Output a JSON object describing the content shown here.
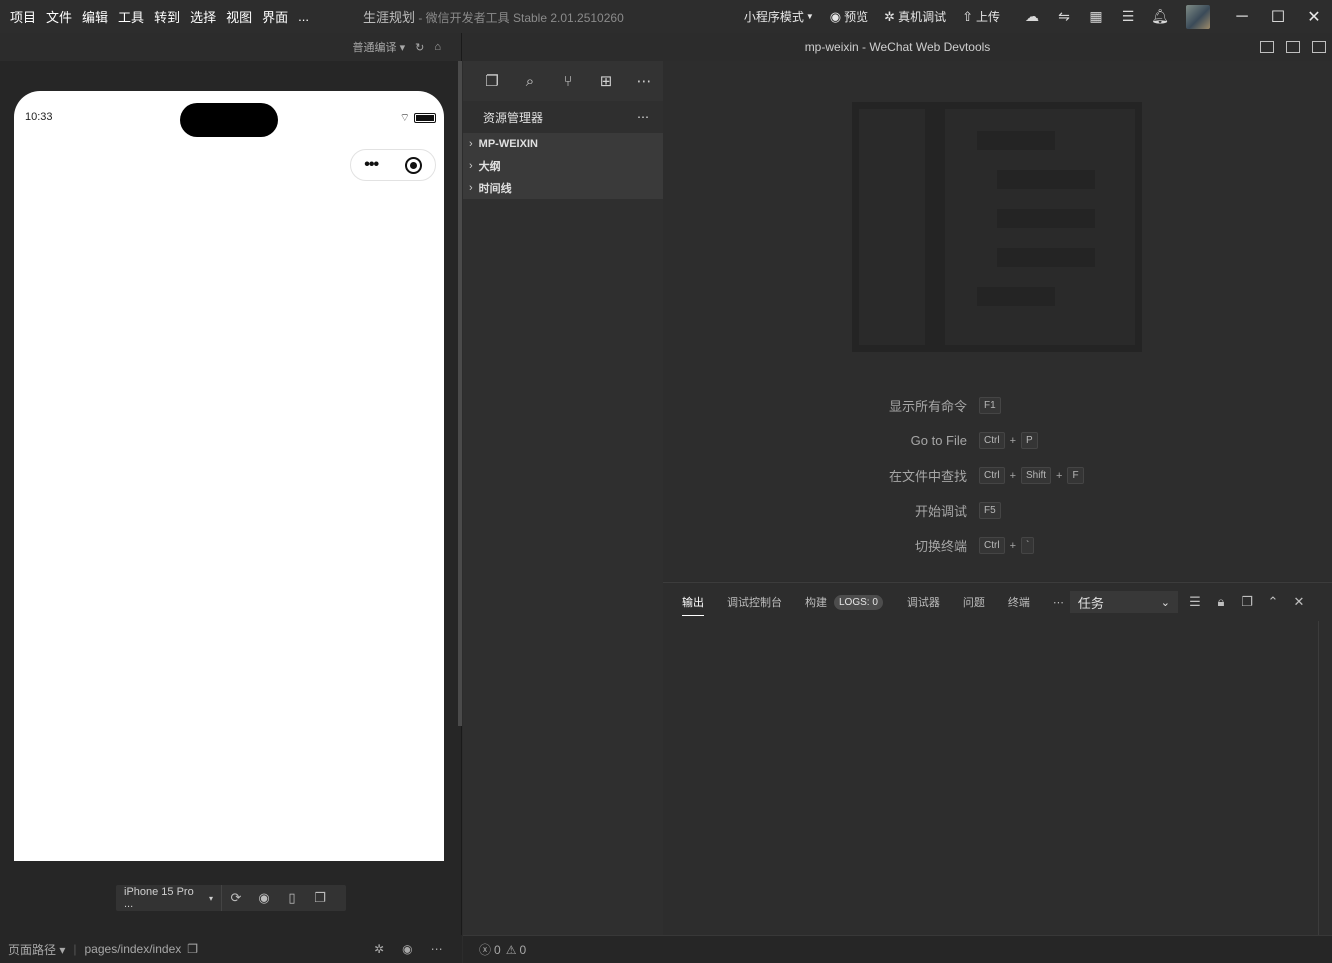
{
  "titlebar": {
    "menu": [
      "项目",
      "文件",
      "编辑",
      "工具",
      "转到",
      "选择",
      "视图",
      "界面",
      "..."
    ],
    "project_name": "生涯规划",
    "app_name": " - 微信开发者工具 Stable 2.01.2510260",
    "mode": "小程序模式",
    "preview": "预览",
    "real_debug": "真机调试",
    "upload": "上传"
  },
  "simulator": {
    "compile_mode": "普通编译",
    "time": "10:33",
    "device": "iPhone 15 Pro ...",
    "page_path_label": "页面路径",
    "page_path": "pages/index/index"
  },
  "editor": {
    "window_title": "mp-weixin - WeChat Web Devtools",
    "explorer_title": "资源管理器",
    "sections": [
      "MP-WEIXIN",
      "大纲",
      "时间线"
    ],
    "shortcuts": [
      {
        "label": "显示所有命令",
        "keys": [
          "F1"
        ]
      },
      {
        "label": "Go to File",
        "keys": [
          "Ctrl",
          "P"
        ]
      },
      {
        "label": "在文件中查找",
        "keys": [
          "Ctrl",
          "Shift",
          "F"
        ]
      },
      {
        "label": "开始调试",
        "keys": [
          "F5"
        ]
      },
      {
        "label": "切换终端",
        "keys": [
          "Ctrl",
          "`"
        ]
      }
    ]
  },
  "panel": {
    "tabs": [
      "输出",
      "调试控制台",
      "构建"
    ],
    "logs_badge": "LOGS: 0",
    "tabs2": [
      "调试器",
      "问题",
      "终端"
    ],
    "task_select": "任务"
  },
  "status": {
    "errors": "0",
    "warnings": "0"
  }
}
